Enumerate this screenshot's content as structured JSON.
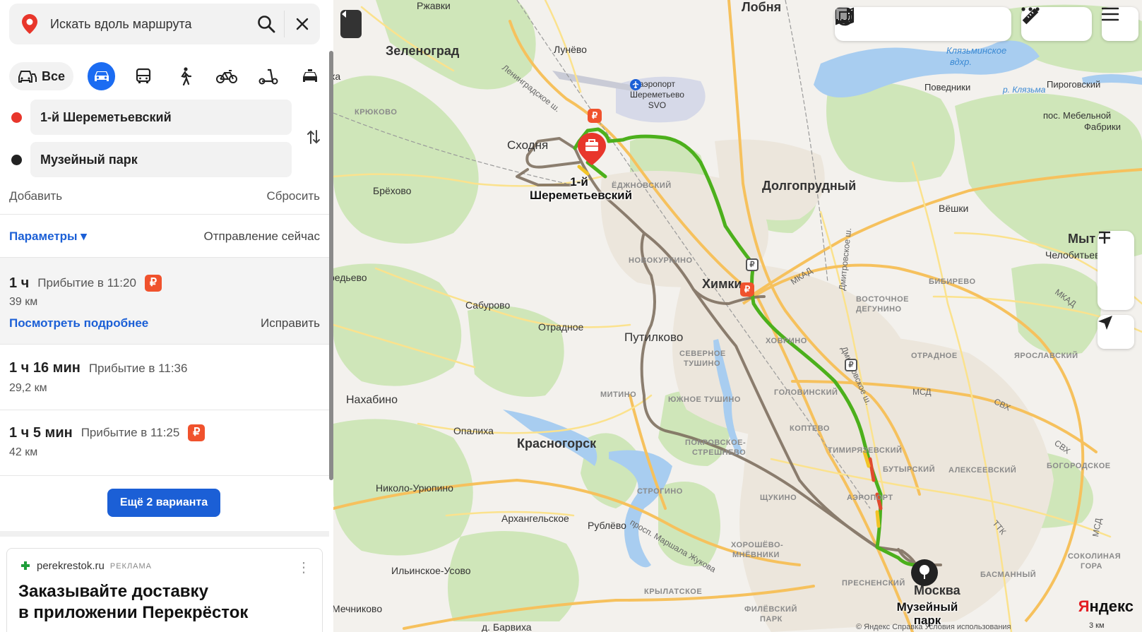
{
  "search": {
    "placeholder": "Искать вдоль маршрута"
  },
  "modes": {
    "all_label": "Все",
    "items": [
      "car-icon",
      "bus-icon",
      "walk-icon",
      "bike-icon",
      "scooter-icon",
      "taxi-icon"
    ],
    "active": "car"
  },
  "waypoints": {
    "from": "1-й Шереметьевский",
    "to": "Музейный парк"
  },
  "actions": {
    "add": "Добавить",
    "reset": "Сбросить"
  },
  "params": {
    "label": "Параметры ▾",
    "departure": "Отправление сейчас"
  },
  "routes": [
    {
      "duration": "1 ч",
      "arrival": "Прибытие в 11:20",
      "distance": "39 км",
      "paid": true,
      "details": "Посмотреть подробнее",
      "fix": "Исправить",
      "selected": true
    },
    {
      "duration": "1 ч 16 мин",
      "arrival": "Прибытие в 11:36",
      "distance": "29,2 км",
      "paid": false
    },
    {
      "duration": "1 ч 5 мин",
      "arrival": "Прибытие в 11:25",
      "distance": "42 км",
      "paid": true
    }
  ],
  "more_variants": "Ещё 2 варианта",
  "rub_symbol": "₽",
  "ad": {
    "source": "perekrestok.ru",
    "tag": "РЕКЛАМА",
    "headline_1": "Заказывайте доставку",
    "headline_2": "в приложении Перекрёсток"
  },
  "map": {
    "labels": {
      "zelenograd": "Зеленоград",
      "lobnya": "Лобня",
      "rzhavki": "Ржавки",
      "lunevo": "Лунёво",
      "skhodnya": "Сходня",
      "dolgoprudny": "Долгопрудный",
      "khimki": "Химки",
      "putilkovo": "Путилково",
      "krasnogorsk": "Красногорск",
      "nakhabino": "Нахабино",
      "moskva": "Москва",
      "brekhovo": "Брёхово",
      "saburovo": "Сабурово",
      "otradnoe": "Отрадное",
      "opalikha": "Опалиха",
      "nikolo_uryupino": "Николо-Урюпино",
      "arkhangelskoe": "Архангельское",
      "rublevo": "Рублёво",
      "ilinskoe_usovo": "Ильинское-Усово",
      "mechnikovo": "Мечниково",
      "barvikha": "д. Барвиха",
      "vyoshki": "Вёшки",
      "chelobitevo": "Челобитьево",
      "povedniki": "Поведники",
      "pirogovsky": "Пироговский",
      "mebelnoy": "пос. Мебельной",
      "fabriki": "Фабрики",
      "myt": "Мыт",
      "ka": "ка",
      "redyevo": "редьево",
      "kryukovo": "КРЮКОВО",
      "novokurkino": "НОВОКУРКИНО",
      "bibirevo": "БИБИРЕВО",
      "vostochnoe": "ВОСТОЧНОЕ",
      "degunino": "ДЕГУНИНО",
      "khovrino": "ХОВРИНО",
      "otradnoe_d": "ОТРАДНОЕ",
      "severnoe": "СЕВЕРНОЕ",
      "tushino": "ТУШИНО",
      "yuzhnoe_tushino": "ЮЖНОЕ ТУШИНО",
      "mitino": "МИТИНО",
      "golovinsky": "ГОЛОВИНСКИЙ",
      "koptevo": "КОПТЕВО",
      "timiryazevsky": "ТИМИРЯЗЕВСКИЙ",
      "butyrsky": "БУТЫРСКИЙ",
      "alekseevsky": "АЛЕКСЕЕВСКИЙ",
      "bogorodskoe": "БОГОРОДСКОЕ",
      "yaroslavsky": "ЯРОСЛАВСКИЙ",
      "pokrovskoe": "ПОКРОВСКОЕ-",
      "streshnevo": "СТРЕШНЕВО",
      "strogino": "СТРОГИНО",
      "shchukino": "ЩУКИНО",
      "khoroshevo": "ХОРОШЁВО-",
      "mnevniki": "МНЁВНИКИ",
      "krylatskoe": "КРЫЛАТСКОЕ",
      "filevsky": "ФИЛЁВСКИЙ",
      "park": "ПАРК",
      "presnensky": "ПРЕСНЕНСКИЙ",
      "basmanny": "БАСМАННЫЙ",
      "sokolinaya": "СОКОЛИНАЯ",
      "gora": "ГОРА",
      "aeroport": "АЭРОПОРТ",
      "sheremetyevsky_d": "ЁДЖНОВСКИЙ",
      "klyazma_1": "Клязьминское",
      "klyazma_2": "вдхр.",
      "r_klyazma": "р. Клязьма",
      "mkad_1": "МКАД",
      "mkad_2": "МКАД",
      "msd": "МСД",
      "svkh_1": "СВХ",
      "svkh_2": "СВХ",
      "ttk": "ТТК",
      "msd_2": "МСД",
      "leningr": "Ленинградское ш.",
      "dmitr": "Дмитровское ш.",
      "dmitr_2": "Дмитровское ш.",
      "marshala": "просп. Маршала Жукова"
    },
    "airport": {
      "line1": "аэропорт",
      "line2": "Шереметьево",
      "line3": "SVO"
    },
    "start_label_1": "1-й",
    "start_label_2": "Шереметьевский",
    "end_label": "Музейный парк",
    "brand_y": "Я",
    "brand_rest": "ндекс",
    "copyright": "© Яндекс  Справка  Условия использования",
    "scale": "3 км"
  },
  "colors": {
    "accent": "#1b6cf2",
    "route_main": "#4cb01c",
    "route_alt": "#7a6a5a",
    "start_pin": "#e8362b"
  }
}
